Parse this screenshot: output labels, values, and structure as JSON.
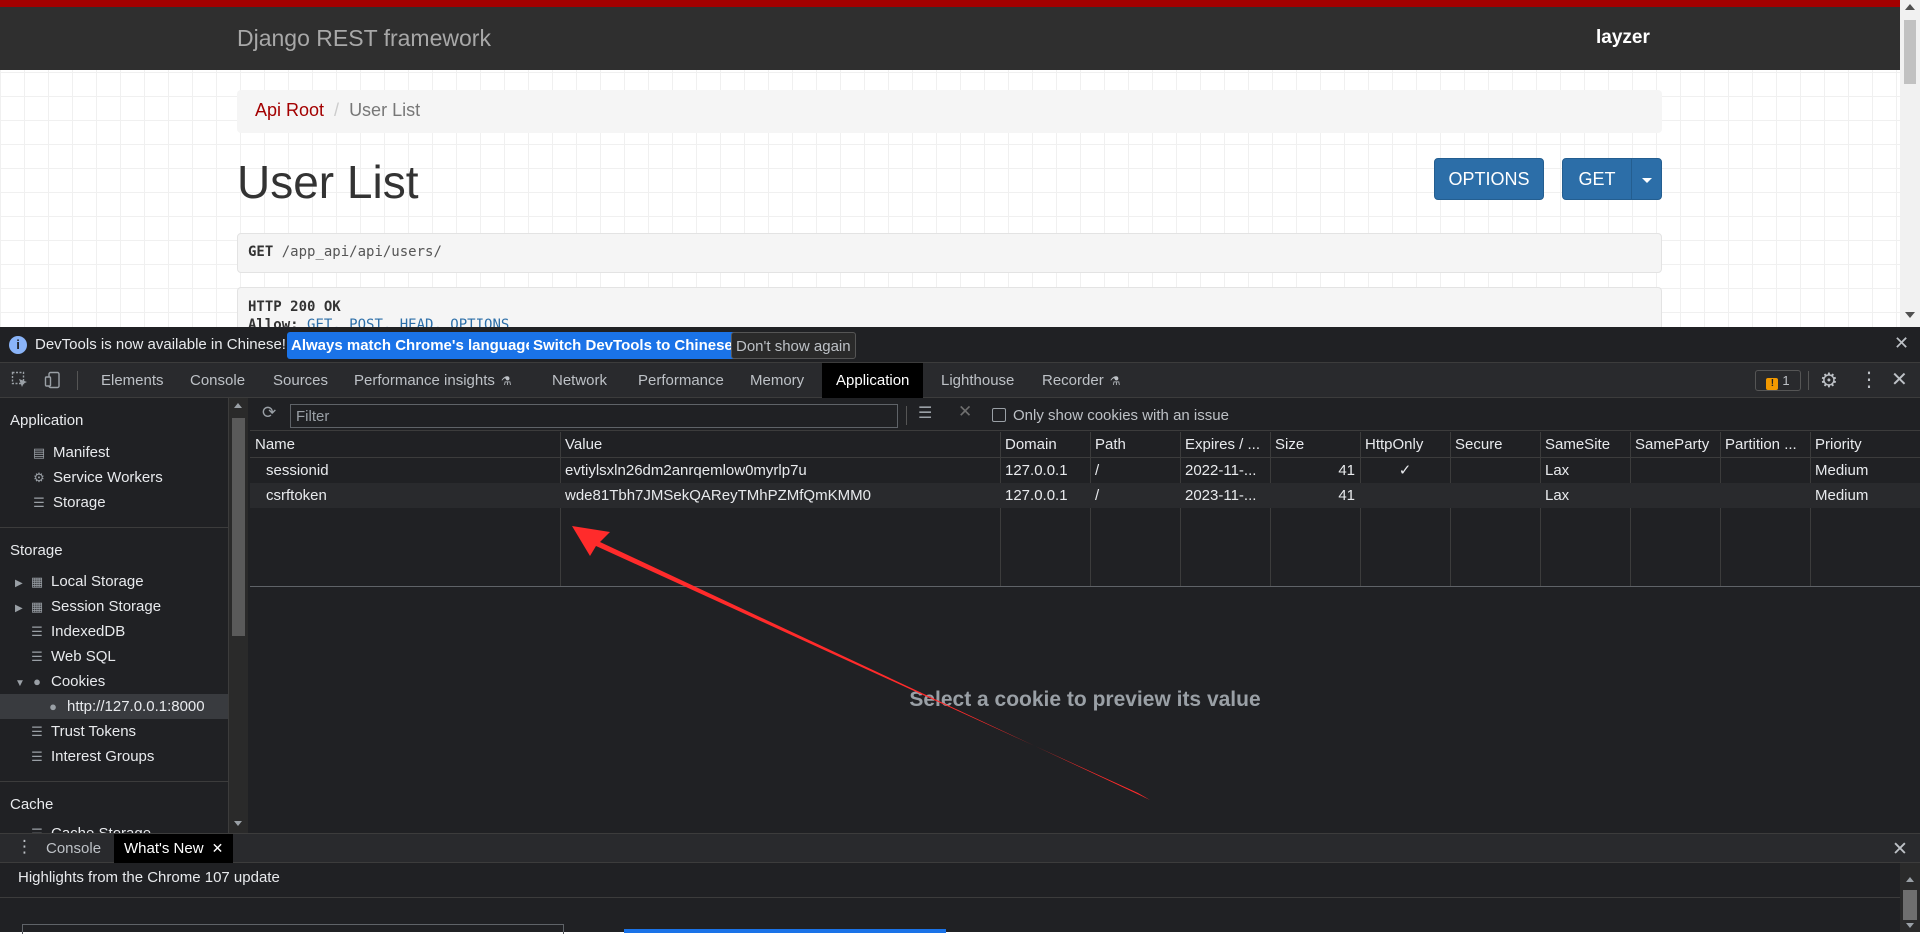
{
  "webpage": {
    "brand": "Django REST framework",
    "user": "layzer",
    "breadcrumb": {
      "root": "Api Root",
      "separator": "/",
      "current": "User List"
    },
    "title": "User List",
    "buttons": {
      "options": "OPTIONS",
      "get": "GET"
    },
    "request": {
      "method": "GET",
      "url": "/app_api/api/users/"
    },
    "response": {
      "status": "HTTP 200 OK",
      "allow_label": "Allow:",
      "allow_values": "GET, POST, HEAD, OPTIONS"
    },
    "colors": {
      "accent": "#a30000",
      "button": "#2c6ea8",
      "navbar": "#2f2f2f"
    }
  },
  "devtools": {
    "infobar": {
      "message": "DevTools is now available in Chinese!",
      "btn_match": "Always match Chrome's language",
      "btn_switch": "Switch DevTools to Chinese",
      "btn_dont": "Don't show again",
      "close": "✕"
    },
    "tabs": {
      "elements": "Elements",
      "console": "Console",
      "sources": "Sources",
      "perf_insights": "Performance insights",
      "network": "Network",
      "performance": "Performance",
      "memory": "Memory",
      "application": "Application",
      "lighthouse": "Lighthouse",
      "recorder": "Recorder",
      "issues_count": "1",
      "close": "✕"
    },
    "sidebar": {
      "application_header": "Application",
      "application_items": [
        "Manifest",
        "Service Workers",
        "Storage"
      ],
      "storage_header": "Storage",
      "storage_items": {
        "local_storage": "Local Storage",
        "session_storage": "Session Storage",
        "indexeddb": "IndexedDB",
        "websql": "Web SQL",
        "cookies": "Cookies",
        "cookie_origin": "http://127.0.0.1:8000",
        "trust_tokens": "Trust Tokens",
        "interest_groups": "Interest Groups"
      },
      "cache_header": "Cache",
      "cache_items": [
        "Cache Storage"
      ]
    },
    "cookies": {
      "filter_placeholder": "Filter",
      "issue_only_label": "Only show cookies with an issue",
      "columns": [
        "Name",
        "Value",
        "Domain",
        "Path",
        "Expires / ...",
        "Size",
        "HttpOnly",
        "Secure",
        "SameSite",
        "SameParty",
        "Partition ...",
        "Priority"
      ],
      "rows": [
        {
          "name": "sessionid",
          "value": "evtiylsxln26dm2anrqemlow0myrlp7u",
          "domain": "127.0.0.1",
          "path": "/",
          "expires": "2022-11-...",
          "size": "41",
          "httponly": "✓",
          "secure": "",
          "samesite": "Lax",
          "sameparty": "",
          "partition": "",
          "priority": "Medium"
        },
        {
          "name": "csrftoken",
          "value": "wde81Tbh7JMSekQAReyTMhPZMfQmKMM0",
          "domain": "127.0.0.1",
          "path": "/",
          "expires": "2023-11-...",
          "size": "41",
          "httponly": "",
          "secure": "",
          "samesite": "Lax",
          "sameparty": "",
          "partition": "",
          "priority": "Medium"
        }
      ],
      "preview_text": "Select a cookie to preview its value"
    },
    "drawer": {
      "tab_console": "Console",
      "tab_whats_new": "What's New",
      "tab_close": "✕",
      "heading": "Highlights from the Chrome 107 update",
      "close": "✕"
    },
    "annotation": {
      "arrow_color": "#ff2b2b"
    }
  }
}
